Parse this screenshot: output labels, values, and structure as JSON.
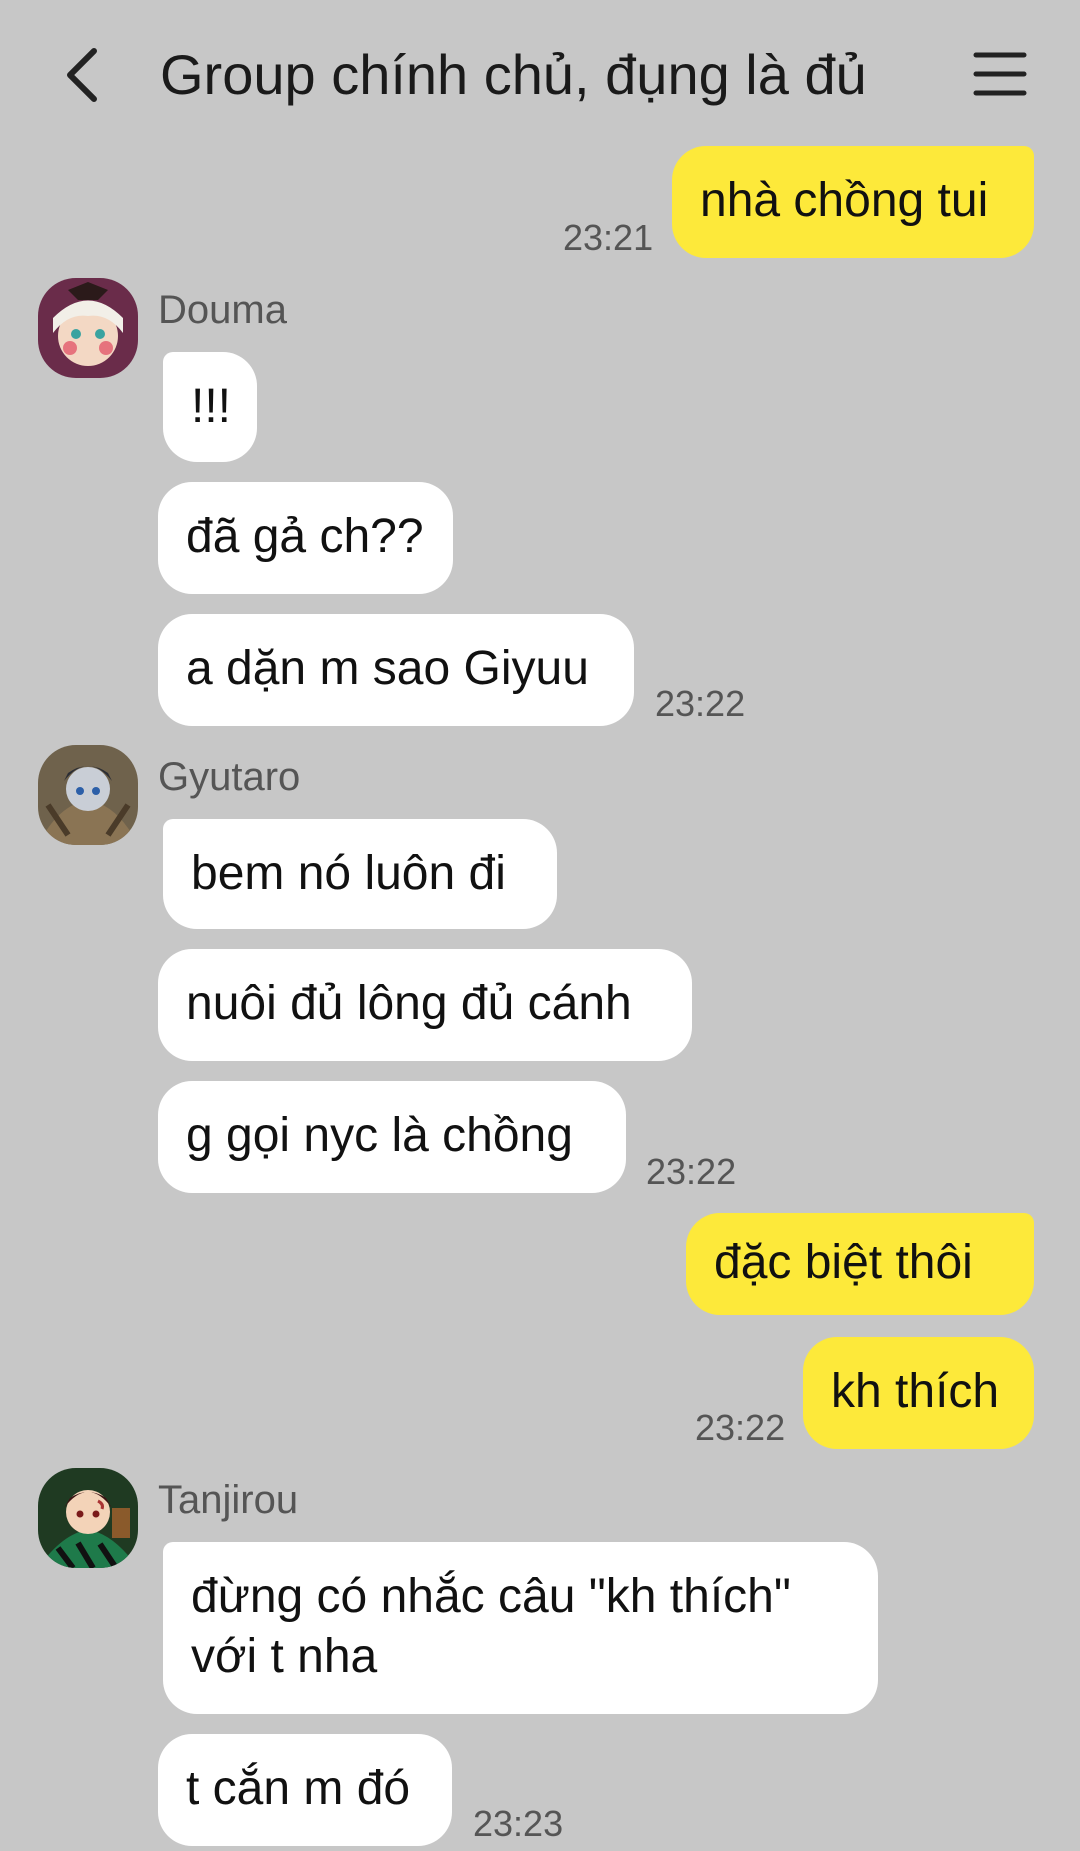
{
  "header": {
    "title": "Group chính chủ, đụng là đủ",
    "back_icon": "chevron-left-icon",
    "menu_icon": "hamburger-menu-icon"
  },
  "messages": {
    "m1": "nhà chồng tui",
    "t1": "23:21",
    "douma": {
      "name": "Douma",
      "b1": "!!!",
      "b2": "đã gả ch??",
      "b3": "a dặn m sao Giyuu",
      "time": "23:22"
    },
    "gyutaro": {
      "name": "Gyutaro",
      "b1": "bem nó luôn đi",
      "b2": "nuôi đủ lông đủ cánh",
      "b3": "g gọi nyc là chồng",
      "time": "23:22"
    },
    "m2": "đặc biệt thôi",
    "m3": "kh thích",
    "t2": "23:22",
    "tanjirou": {
      "name": "Tanjirou",
      "b1": "đừng có nhắc câu \"kh thích\"\nvới t nha",
      "b2": "t cắn m đó",
      "time": "23:23"
    }
  },
  "colors": {
    "background": "#c7c7c7",
    "outgoing_bubble": "#fde93a",
    "incoming_bubble": "#ffffff"
  }
}
